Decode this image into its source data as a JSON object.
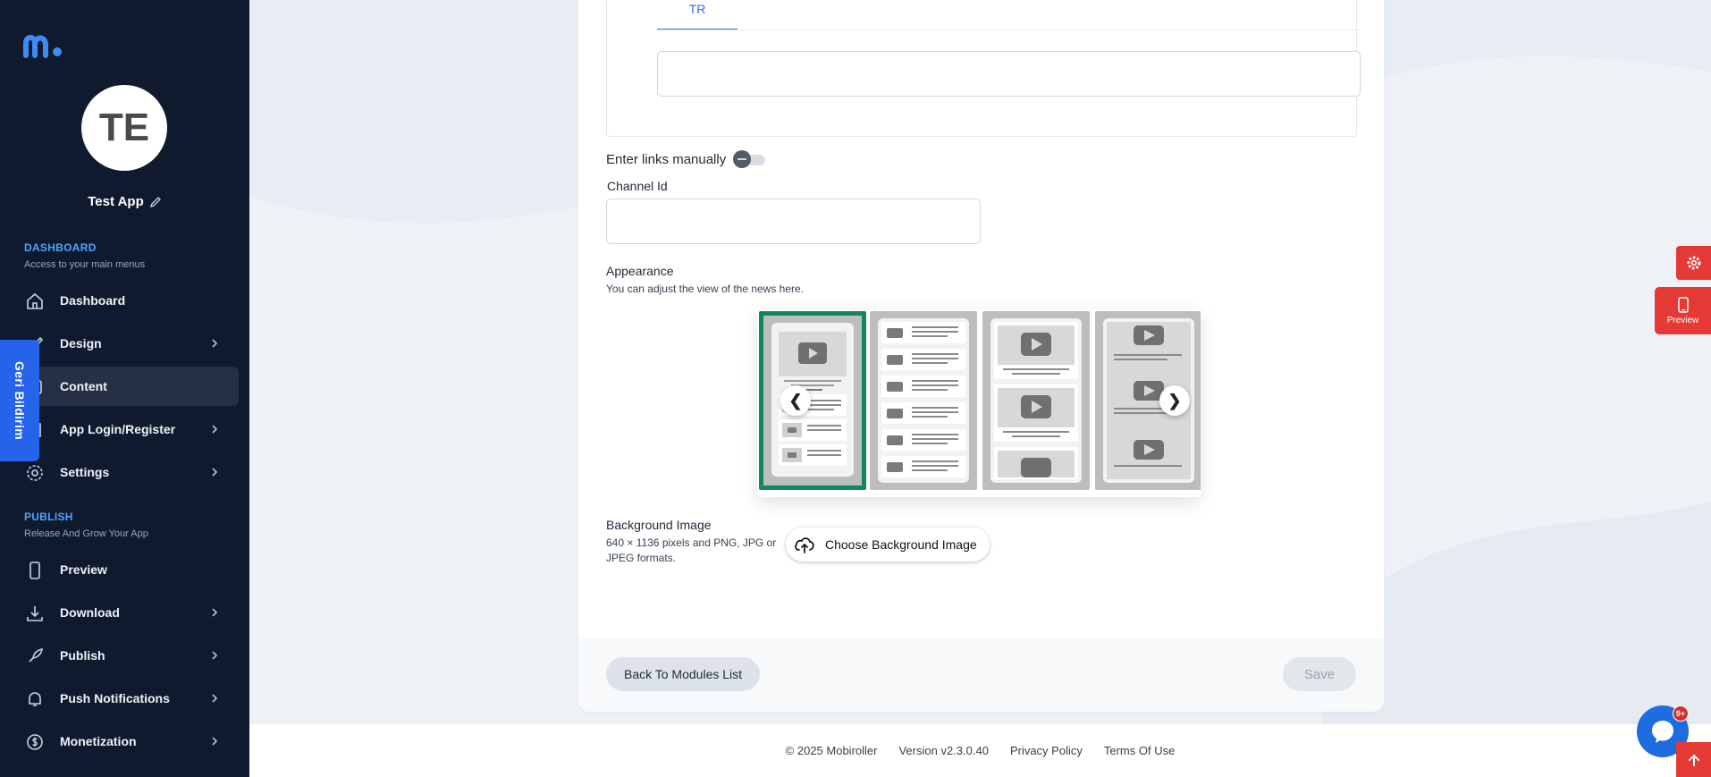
{
  "app": {
    "initials": "TE",
    "name": "Test App"
  },
  "sidebar": {
    "sections": [
      {
        "title": "DASHBOARD",
        "subtitle": "Access to your main menus"
      },
      {
        "title": "PUBLISH",
        "subtitle": "Release And Grow Your App"
      }
    ],
    "items": [
      {
        "label": "Dashboard",
        "icon": "home-icon",
        "chevron": false
      },
      {
        "label": "Design",
        "icon": "brush-icon",
        "chevron": true
      },
      {
        "label": "Content",
        "icon": "content-icon",
        "chevron": false,
        "active": true
      },
      {
        "label": "App Login/Register",
        "icon": "login-icon",
        "chevron": true
      },
      {
        "label": "Settings",
        "icon": "gear-icon",
        "chevron": true
      },
      {
        "label": "Preview",
        "icon": "phone-icon",
        "chevron": false
      },
      {
        "label": "Download",
        "icon": "download-icon",
        "chevron": true
      },
      {
        "label": "Publish",
        "icon": "rocket-icon",
        "chevron": true
      },
      {
        "label": "Push Notifications",
        "icon": "bell-icon",
        "chevron": true
      },
      {
        "label": "Monetization",
        "icon": "dollar-icon",
        "chevron": true
      }
    ]
  },
  "feedback_tab": "Geri Bildirim",
  "form": {
    "language_tab": "TR",
    "language_input_value": "",
    "enter_links_label": "Enter links manually",
    "enter_links_enabled": false,
    "channel_id_label": "Channel Id",
    "channel_id_value": "",
    "appearance_title": "Appearance",
    "appearance_subtitle": "You can adjust the view of the news here.",
    "appearance_prev": "❮",
    "appearance_next": "❯",
    "selected_layout": 1,
    "background_title": "Background Image",
    "background_subtitle": "640 × 1136 pixels and PNG, JPG or JPEG formats.",
    "choose_background_label": "Choose Background Image"
  },
  "footer_actions": {
    "back_label": "Back To Modules List",
    "save_label": "Save"
  },
  "page_footer": {
    "copyright": "© 2025 Mobiroller",
    "version": "Version v2.3.0.40",
    "privacy": "Privacy Policy",
    "terms": "Terms Of Use"
  },
  "side_tools": {
    "preview_label": "Preview"
  },
  "chat": {
    "badge": "9+"
  },
  "colors": {
    "sidebar_bg": "#101a2e",
    "accent_blue": "#2563eb",
    "accent_red": "#e53935",
    "selected_green": "#11875b"
  }
}
